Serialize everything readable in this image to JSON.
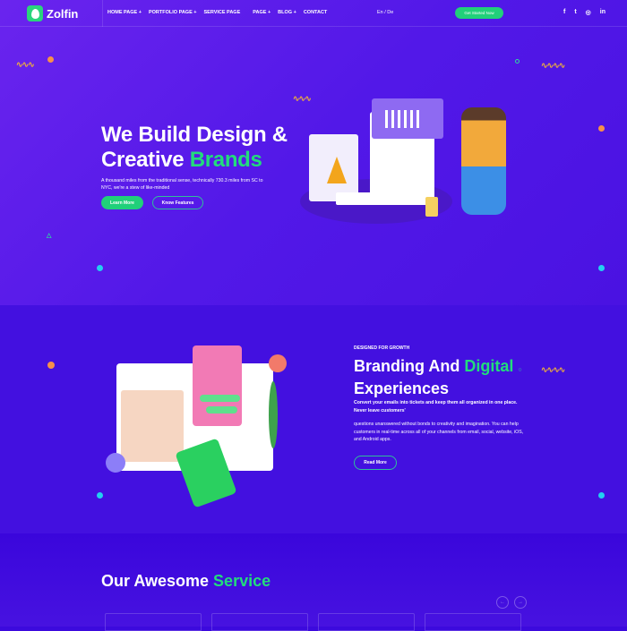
{
  "nav": {
    "brand": "Zolfin",
    "items": [
      "HOME PAGE +",
      "PORTFOLIO PAGE +",
      "SERVICE PAGE",
      "PAGE +",
      "BLOG +",
      "CONTACT"
    ],
    "lang": "En / De",
    "cta": "Get Started Now",
    "social": [
      "f",
      "t",
      "◎",
      "in"
    ]
  },
  "hero": {
    "title_line1": "We Build Design &",
    "title_line2_plain": "Creative ",
    "title_line2_accent": "Brands",
    "text": "A thousand miles from the traditional sense, technically 730.3 miles from SC to NYC, we're a stew of like-minded",
    "btn_primary": "Learn More",
    "btn_secondary": "Know Features"
  },
  "branding": {
    "eyebrow": "DESIGNED FOR GROWTH",
    "title_plain": "Branding And ",
    "title_accent": "Digital",
    "title_line2": "Experiences",
    "text_bold": "Convert your emails into tickets and keep them all organized in one place. Never leave customers'",
    "text": "questions unanswered without bonds to creativity and imagination. You can help customers in real-time across all of your channels from email, social, website, iOS, and Android apps.",
    "button": "Read More"
  },
  "services": {
    "title_plain": "Our Awesome ",
    "title_accent": "Service",
    "prev": "←",
    "next": "→"
  },
  "colors": {
    "accent": "#22dc7c",
    "hero_bg": "#5a1ce8",
    "section_bg": "#4310e0"
  }
}
